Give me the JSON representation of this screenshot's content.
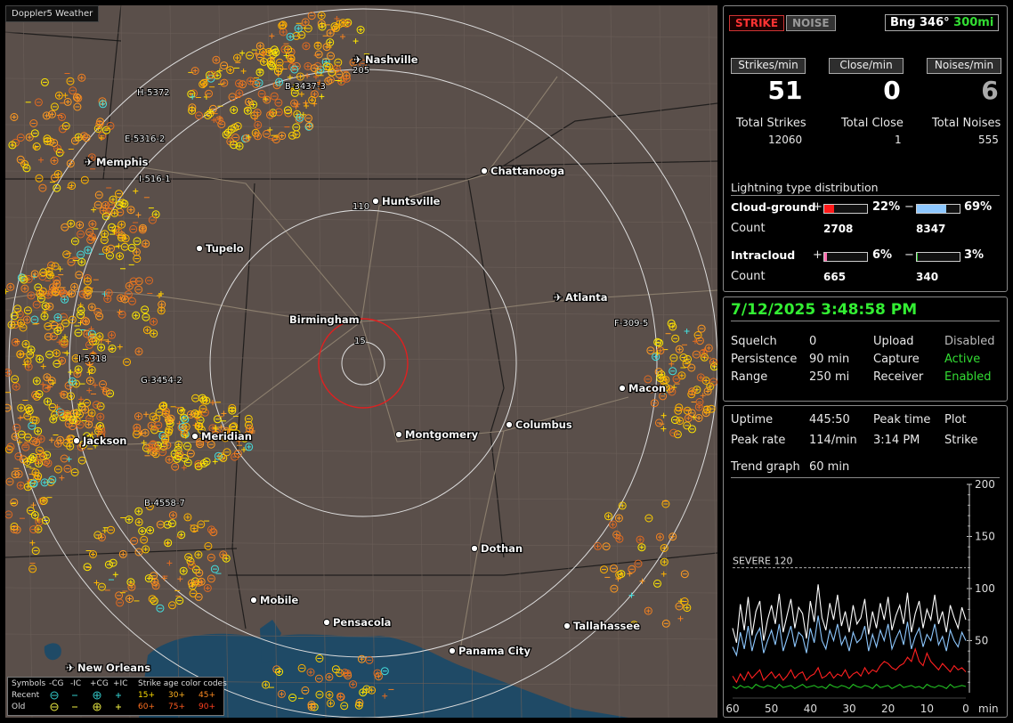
{
  "app": {
    "title": "Doppler5 Weather"
  },
  "map": {
    "cities": [
      {
        "name": "Nashville",
        "icon": "airport-icon"
      },
      {
        "name": "Memphis",
        "icon": "airport-icon"
      },
      {
        "name": "Chattanooga",
        "icon": "city-dot-icon"
      },
      {
        "name": "Huntsville",
        "icon": "city-dot-icon"
      },
      {
        "name": "Tupelo",
        "icon": "city-dot-icon"
      },
      {
        "name": "Atlanta",
        "icon": "airport-icon"
      },
      {
        "name": "Birmingham",
        "icon": "city-dot-icon"
      },
      {
        "name": "Macon",
        "icon": "city-dot-icon"
      },
      {
        "name": "Jackson",
        "icon": "city-dot-icon"
      },
      {
        "name": "Meridian",
        "icon": "city-dot-icon"
      },
      {
        "name": "Montgomery",
        "icon": "city-dot-icon"
      },
      {
        "name": "Columbus",
        "icon": "city-dot-icon"
      },
      {
        "name": "Dothan",
        "icon": "city-dot-icon"
      },
      {
        "name": "Mobile",
        "icon": "city-dot-icon"
      },
      {
        "name": "Pensacola",
        "icon": "city-dot-icon"
      },
      {
        "name": "Tallahassee",
        "icon": "city-dot-icon"
      },
      {
        "name": "Panama City",
        "icon": "city-dot-icon"
      },
      {
        "name": "New Orleans",
        "icon": "airport-icon"
      }
    ],
    "tracks": [
      "H-5372",
      "E-5316-2",
      "B-3437-3",
      "205",
      "I-516-1",
      "110",
      "F-309-5",
      "I-5318",
      "G-3454-2",
      "B-4558-7",
      "15"
    ]
  },
  "legend": {
    "row_headers": [
      "Symbols",
      "-CG",
      "-IC",
      "+CG",
      "+IC",
      "Strike age color codes"
    ],
    "recent_label": "Recent",
    "old_label": "Old",
    "recent_ages": [
      "15+",
      "30+",
      "45+"
    ],
    "old_ages": [
      "60+",
      "75+",
      "90+"
    ]
  },
  "status": {
    "strike_btn": "STRIKE",
    "noise_btn": "NOISE",
    "bearing": "Bng 346°",
    "range": "300mi"
  },
  "counters": [
    {
      "header": "Strikes/min",
      "value": "51",
      "total_label": "Total Strikes",
      "total": "12060"
    },
    {
      "header": "Close/min",
      "value": "0",
      "total_label": "Total Close",
      "total": "1"
    },
    {
      "header": "Noises/min",
      "value": "6",
      "total_label": "Total Noises",
      "total": "555"
    }
  ],
  "distribution": {
    "title": "Lightning type distribution",
    "cg_label": "Cloud-ground",
    "cg_pos_sign": "+",
    "cg_pos_pct": "22%",
    "cg_pos_frac": 0.22,
    "cg_neg_sign": "−",
    "cg_neg_pct": "69%",
    "cg_neg_frac": 0.69,
    "cg_count_label": "Count",
    "cg_pos_count": "2708",
    "cg_neg_count": "8347",
    "ic_label": "Intracloud",
    "ic_pos_sign": "+",
    "ic_pos_pct": "6%",
    "ic_pos_frac": 0.06,
    "ic_neg_sign": "−",
    "ic_neg_pct": "3%",
    "ic_neg_frac": 0.03,
    "ic_count_label": "Count",
    "ic_pos_count": "665",
    "ic_neg_count": "340",
    "colors": {
      "cg_pos": "#ff1a1a",
      "cg_neg": "#8ec8ff",
      "ic_pos": "#ff70b0",
      "ic_neg": "#22c022"
    }
  },
  "settings": {
    "datetime": "7/12/2025 3:48:58 PM",
    "squelch_label": "Squelch",
    "squelch": "0",
    "persistence_label": "Persistence",
    "persistence": "90 min",
    "range_label": "Range",
    "range": "250 mi",
    "upload_label": "Upload",
    "upload": "Disabled",
    "capture_label": "Capture",
    "capture": "Active",
    "receiver_label": "Receiver",
    "receiver": "Enabled"
  },
  "stats": {
    "uptime_label": "Uptime",
    "uptime": "445:50",
    "peak_time_label": "Peak time",
    "peak_time": "3:14 PM",
    "plot_label": "Plot",
    "plot": "Strike",
    "peak_rate_label": "Peak rate",
    "peak_rate": "114/min",
    "trend_label": "Trend graph",
    "trend": "60 min"
  },
  "chart_data": {
    "type": "line",
    "x": [
      60,
      59,
      58,
      57,
      56,
      55,
      54,
      53,
      52,
      51,
      50,
      49,
      48,
      47,
      46,
      45,
      44,
      43,
      42,
      41,
      40,
      39,
      38,
      37,
      36,
      35,
      34,
      33,
      32,
      31,
      30,
      29,
      28,
      27,
      26,
      25,
      24,
      23,
      22,
      21,
      20,
      19,
      18,
      17,
      16,
      15,
      14,
      13,
      12,
      11,
      10,
      9,
      8,
      7,
      6,
      5,
      4,
      3,
      2,
      1,
      0
    ],
    "x_ticks": [
      "60",
      "50",
      "40",
      "30",
      "20",
      "10",
      "0"
    ],
    "x_unit": "min",
    "y_ticks": [
      "200",
      "150",
      "100",
      "50"
    ],
    "ylim": [
      0,
      200
    ],
    "severe_label": "SEVERE 120",
    "severe_value": 120,
    "series": [
      {
        "color": "#ffffff",
        "values": [
          62,
          48,
          85,
          60,
          92,
          55,
          78,
          88,
          50,
          70,
          84,
          66,
          95,
          58,
          74,
          90,
          62,
          82,
          76,
          52,
          88,
          68,
          104,
          72,
          60,
          86,
          70,
          94,
          64,
          78,
          58,
          84,
          66,
          72,
          90,
          56,
          78,
          62,
          86,
          70,
          92,
          60,
          74,
          84,
          66,
          96,
          58,
          76,
          88,
          62,
          80,
          70,
          94,
          66,
          78,
          58,
          84,
          72,
          62,
          82,
          70
        ]
      },
      {
        "color": "#8ec8ff",
        "values": [
          44,
          36,
          58,
          42,
          64,
          40,
          55,
          62,
          38,
          50,
          60,
          46,
          66,
          40,
          52,
          64,
          44,
          58,
          54,
          38,
          62,
          48,
          74,
          50,
          42,
          60,
          50,
          66,
          46,
          54,
          40,
          58,
          48,
          52,
          64,
          40,
          56,
          44,
          60,
          50,
          66,
          42,
          52,
          60,
          46,
          68,
          42,
          54,
          62,
          44,
          56,
          50,
          66,
          46,
          54,
          40,
          60,
          50,
          44,
          58,
          50
        ]
      },
      {
        "color": "#ff2020",
        "values": [
          16,
          10,
          18,
          12,
          20,
          14,
          18,
          22,
          12,
          16,
          20,
          14,
          18,
          12,
          16,
          22,
          14,
          18,
          20,
          12,
          16,
          18,
          24,
          14,
          16,
          20,
          14,
          18,
          16,
          22,
          14,
          18,
          20,
          16,
          24,
          18,
          22,
          20,
          26,
          30,
          28,
          24,
          22,
          26,
          28,
          34,
          30,
          42,
          30,
          26,
          38,
          30,
          26,
          22,
          28,
          24,
          20,
          26,
          22,
          24,
          20
        ]
      },
      {
        "color": "#22c022",
        "values": [
          6,
          4,
          7,
          5,
          6,
          4,
          8,
          6,
          5,
          7,
          6,
          4,
          8,
          5,
          6,
          7,
          4,
          6,
          8,
          5,
          6,
          7,
          5,
          6,
          4,
          8,
          6,
          5,
          7,
          6,
          4,
          8,
          6,
          5,
          7,
          6,
          4,
          8,
          5,
          6,
          7,
          4,
          6,
          8,
          5,
          6,
          7,
          5,
          6,
          4,
          8,
          6,
          5,
          7,
          6,
          4,
          8,
          5,
          6,
          7,
          6
        ]
      }
    ]
  }
}
